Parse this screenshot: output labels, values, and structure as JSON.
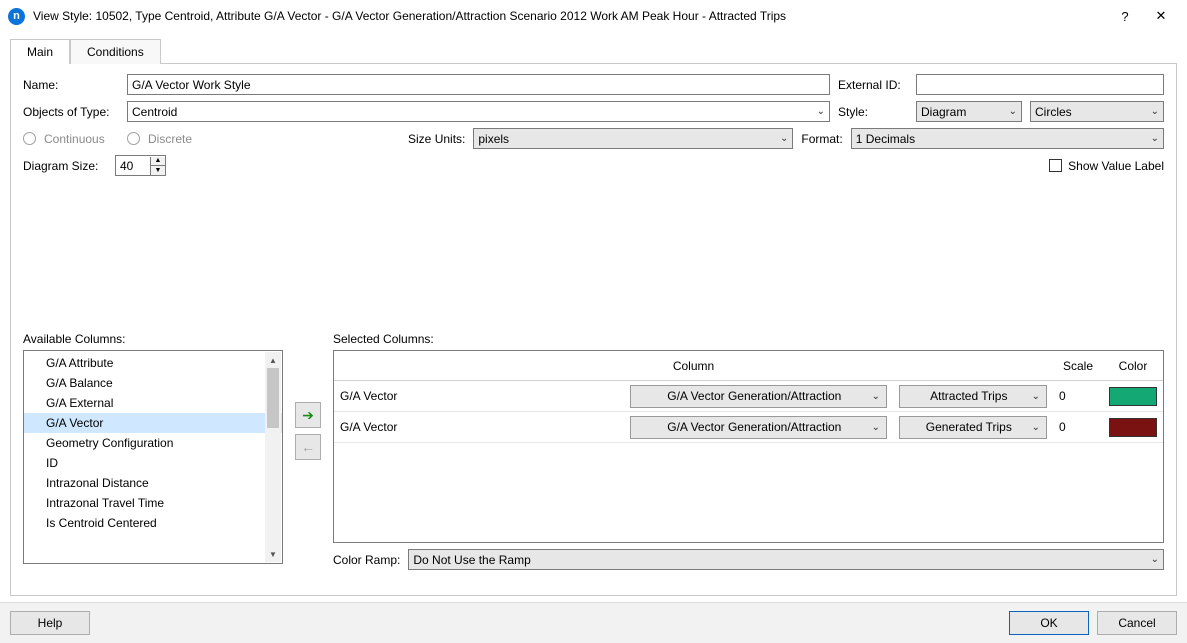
{
  "window": {
    "title": "View Style: 10502, Type Centroid, Attribute G/A Vector - G/A Vector Generation/Attraction Scenario 2012 Work AM Peak Hour - Attracted Trips",
    "help_glyph": "?",
    "close_glyph": "✕"
  },
  "tabs": [
    "Main",
    "Conditions"
  ],
  "labels": {
    "name": "Name:",
    "external_id": "External ID:",
    "objects_of_type": "Objects of Type:",
    "style": "Style:",
    "continuous": "Continuous",
    "discrete": "Discrete",
    "size_units": "Size Units:",
    "format": "Format:",
    "diagram_size": "Diagram Size:",
    "show_value_label": "Show Value Label",
    "available_columns": "Available Columns:",
    "selected_columns": "Selected Columns:",
    "color_ramp": "Color Ramp:",
    "column_header": "Column",
    "scale_header": "Scale",
    "color_header": "Color"
  },
  "fields": {
    "name": "G/A Vector Work Style",
    "external_id": "",
    "objects_of_type": "Centroid",
    "style_a": "Diagram",
    "style_b": "Circles",
    "size_units": "pixels",
    "format": "1 Decimals",
    "diagram_size": "40",
    "color_ramp": "Do Not Use the Ramp"
  },
  "available_columns": [
    "G/A Attribute",
    "G/A Balance",
    "G/A External",
    "G/A Vector",
    "Geometry Configuration",
    "ID",
    "Intrazonal Distance",
    "Intrazonal Travel Time",
    "Is Centroid Centered"
  ],
  "available_columns_selected_index": 3,
  "selected_columns": [
    {
      "name": "G/A Vector",
      "column": "G/A Vector Generation/Attraction",
      "sub": "Attracted Trips",
      "scale": "0",
      "color": "#14a874"
    },
    {
      "name": "G/A Vector",
      "column": "G/A Vector Generation/Attraction",
      "sub": "Generated Trips",
      "scale": "0",
      "color": "#7a1212"
    }
  ],
  "buttons": {
    "help": "Help",
    "ok": "OK",
    "cancel": "Cancel",
    "move_right": "➔",
    "move_left": "←"
  },
  "glyphs": {
    "caret": "⌄",
    "spinner_up": "▲",
    "spinner_down": "▼",
    "scroll_up": "▲",
    "scroll_down": "▼"
  }
}
